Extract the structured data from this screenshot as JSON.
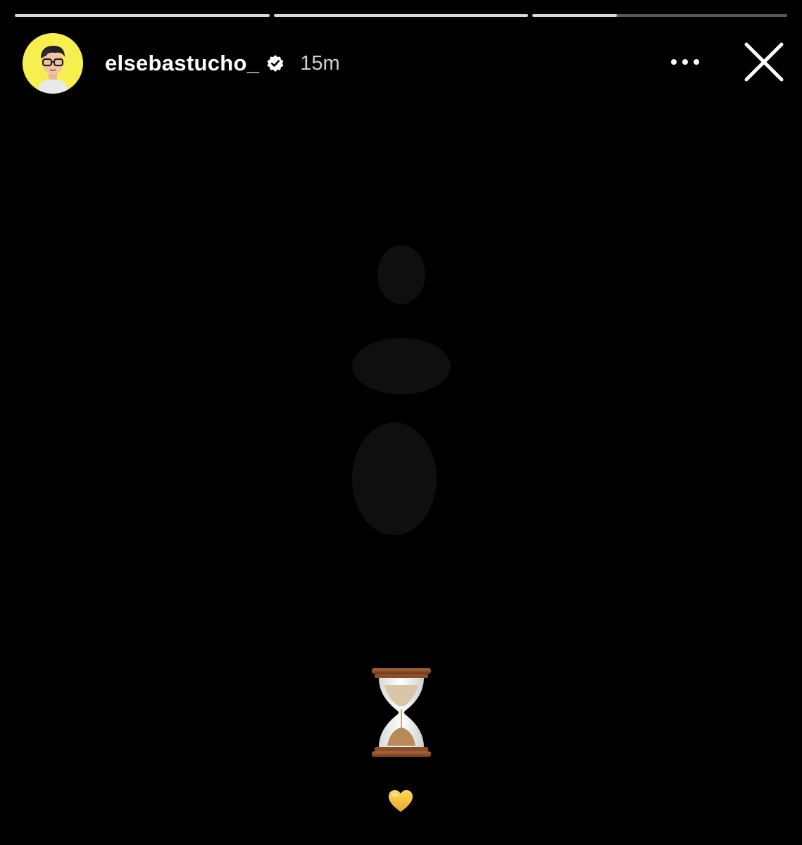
{
  "story": {
    "progress_segments": [
      1.0,
      1.0,
      0.33
    ],
    "user": {
      "username": "elsebastucho_",
      "verified": true,
      "time_ago": "15m",
      "avatar_bg": "#f7ee4f"
    },
    "icons": {
      "more": "more-horizontal-icon",
      "close": "close-icon",
      "verified": "verified-badge-icon",
      "content_1": "hourglass-emoji",
      "content_2": "yellow-heart-emoji"
    },
    "colors": {
      "background": "#000000",
      "progress_track": "rgba(255,255,255,0.35)",
      "progress_fill": "#d8d8d8",
      "heart": "#f4c542"
    }
  }
}
